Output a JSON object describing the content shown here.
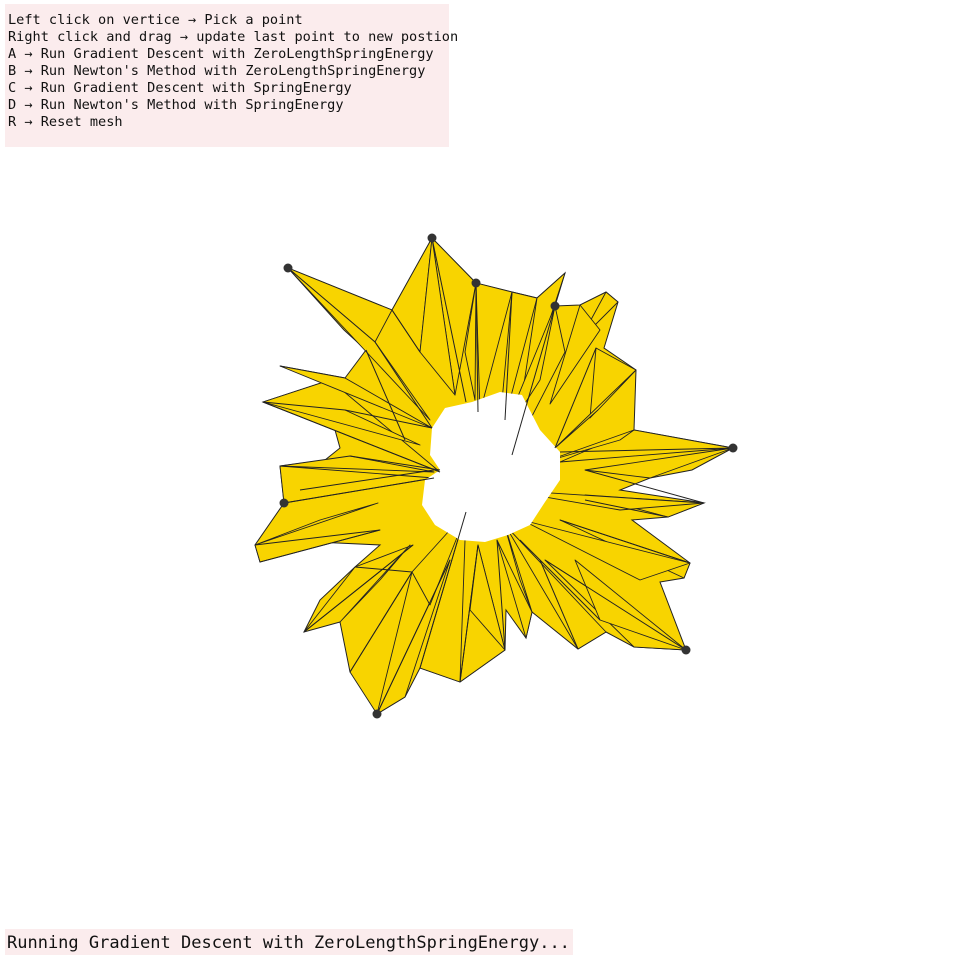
{
  "help": {
    "lines": [
      "Left click on vertice → Pick a point",
      "Right click and drag → update last point to new postion",
      "A → Run Gradient Descent with ZeroLengthSpringEnergy",
      "B → Run Newton's Method with ZeroLengthSpringEnergy",
      "C → Run Gradient Descent with SpringEnergy",
      "D → Run Newton's Method with SpringEnergy",
      "R → Reset mesh"
    ]
  },
  "status": {
    "text": "Running Gradient Descent with ZeroLengthSpringEnergy..."
  },
  "mesh": {
    "fill_color": "#f8d400",
    "edge_color": "#222222",
    "handle_color": "#333333",
    "pinned_point_count": 8
  }
}
